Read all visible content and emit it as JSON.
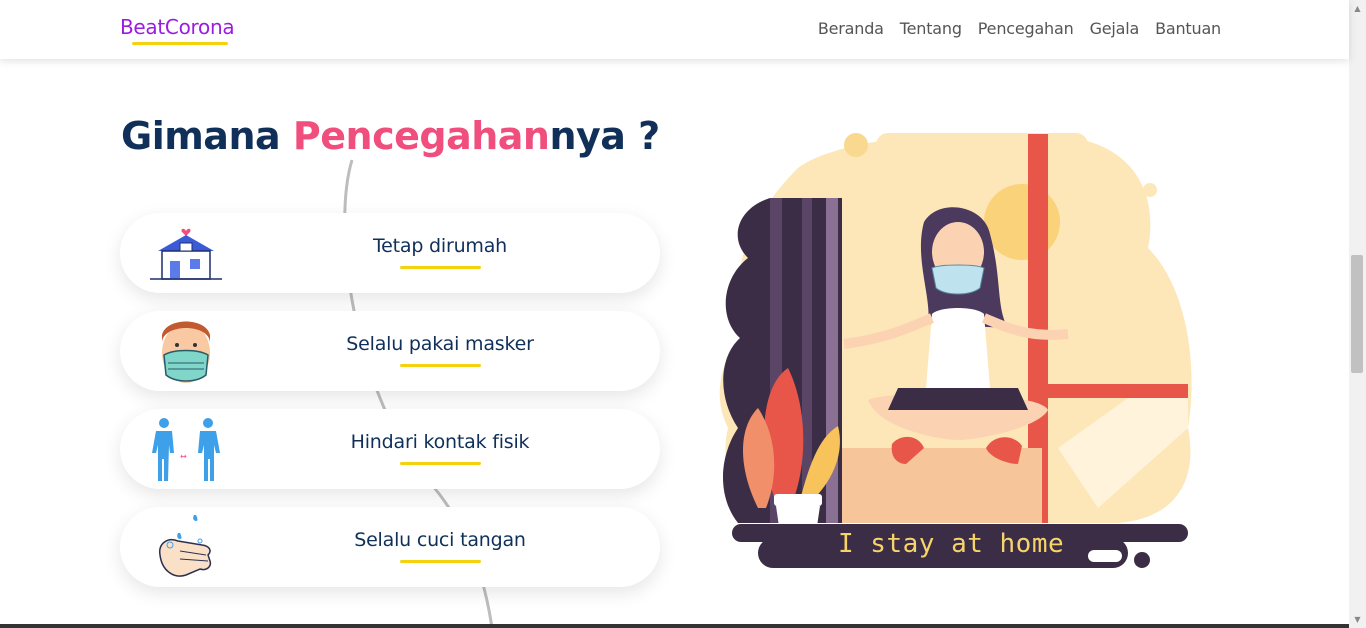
{
  "navbar": {
    "brand": "BeatCorona",
    "links": [
      "Beranda",
      "Tentang",
      "Pencegahan",
      "Gejala",
      "Bantuan"
    ]
  },
  "section": {
    "heading_part1": "Gimana ",
    "heading_highlight": "Pencegahan",
    "heading_part2": "nya ?",
    "items": [
      {
        "label": "Tetap dirumah",
        "icon": "house-icon"
      },
      {
        "label": "Selalu pakai masker",
        "icon": "masked-face-icon"
      },
      {
        "label": "Hindari kontak fisik",
        "icon": "social-distance-icon"
      },
      {
        "label": "Selalu cuci tangan",
        "icon": "hand-wash-icon"
      }
    ]
  },
  "illustration": {
    "caption": "I stay at home"
  },
  "colors": {
    "brand": "#9b1ddf",
    "accent_yellow": "#f5d20e",
    "heading": "#10305a",
    "highlight_pink": "#f04e7c"
  }
}
